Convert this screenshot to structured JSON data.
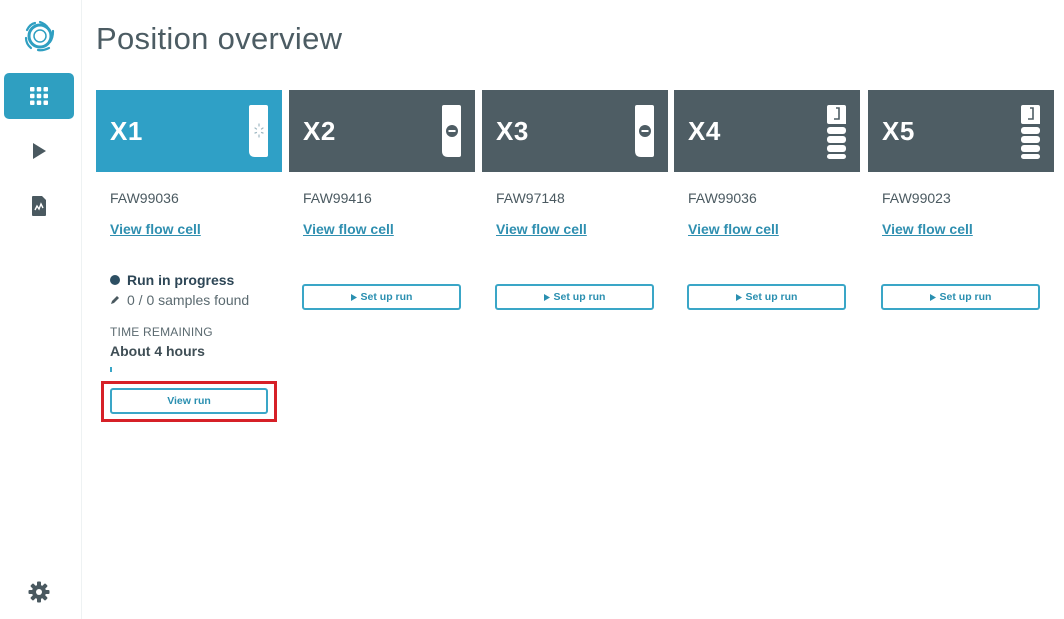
{
  "page": {
    "title": "Position overview"
  },
  "colors": {
    "accent": "#2fa0c6",
    "idle_header": "#4e5d64",
    "highlight": "#d62027"
  },
  "sidebar": {
    "logo_icon": "swirl-logo-icon",
    "items": [
      {
        "icon": "grid-icon",
        "active": true
      },
      {
        "icon": "play-icon",
        "active": false
      },
      {
        "icon": "report-icon",
        "active": false
      },
      {
        "icon": "gear-icon",
        "active": false
      }
    ]
  },
  "positions": [
    {
      "label": "X1",
      "flow_cell_id": "FAW99036",
      "view_flow_cell": "View flow cell",
      "state": "running",
      "run_status": "Run in progress",
      "samples": "0 / 0 samples found",
      "time_label": "TIME REMAINING",
      "time_value": "About 4 hours",
      "progress": 0.01,
      "button": "View run"
    },
    {
      "label": "X2",
      "flow_cell_id": "FAW99416",
      "view_flow_cell": "View flow cell",
      "state": "idle",
      "button": "Set up run"
    },
    {
      "label": "X3",
      "flow_cell_id": "FAW97148",
      "view_flow_cell": "View flow cell",
      "state": "idle",
      "button": "Set up run"
    },
    {
      "label": "X4",
      "flow_cell_id": "FAW99036",
      "view_flow_cell": "View flow cell",
      "state": "idle",
      "button": "Set up run"
    },
    {
      "label": "X5",
      "flow_cell_id": "FAW99023",
      "view_flow_cell": "View flow cell",
      "state": "idle",
      "button": "Set up run"
    }
  ]
}
